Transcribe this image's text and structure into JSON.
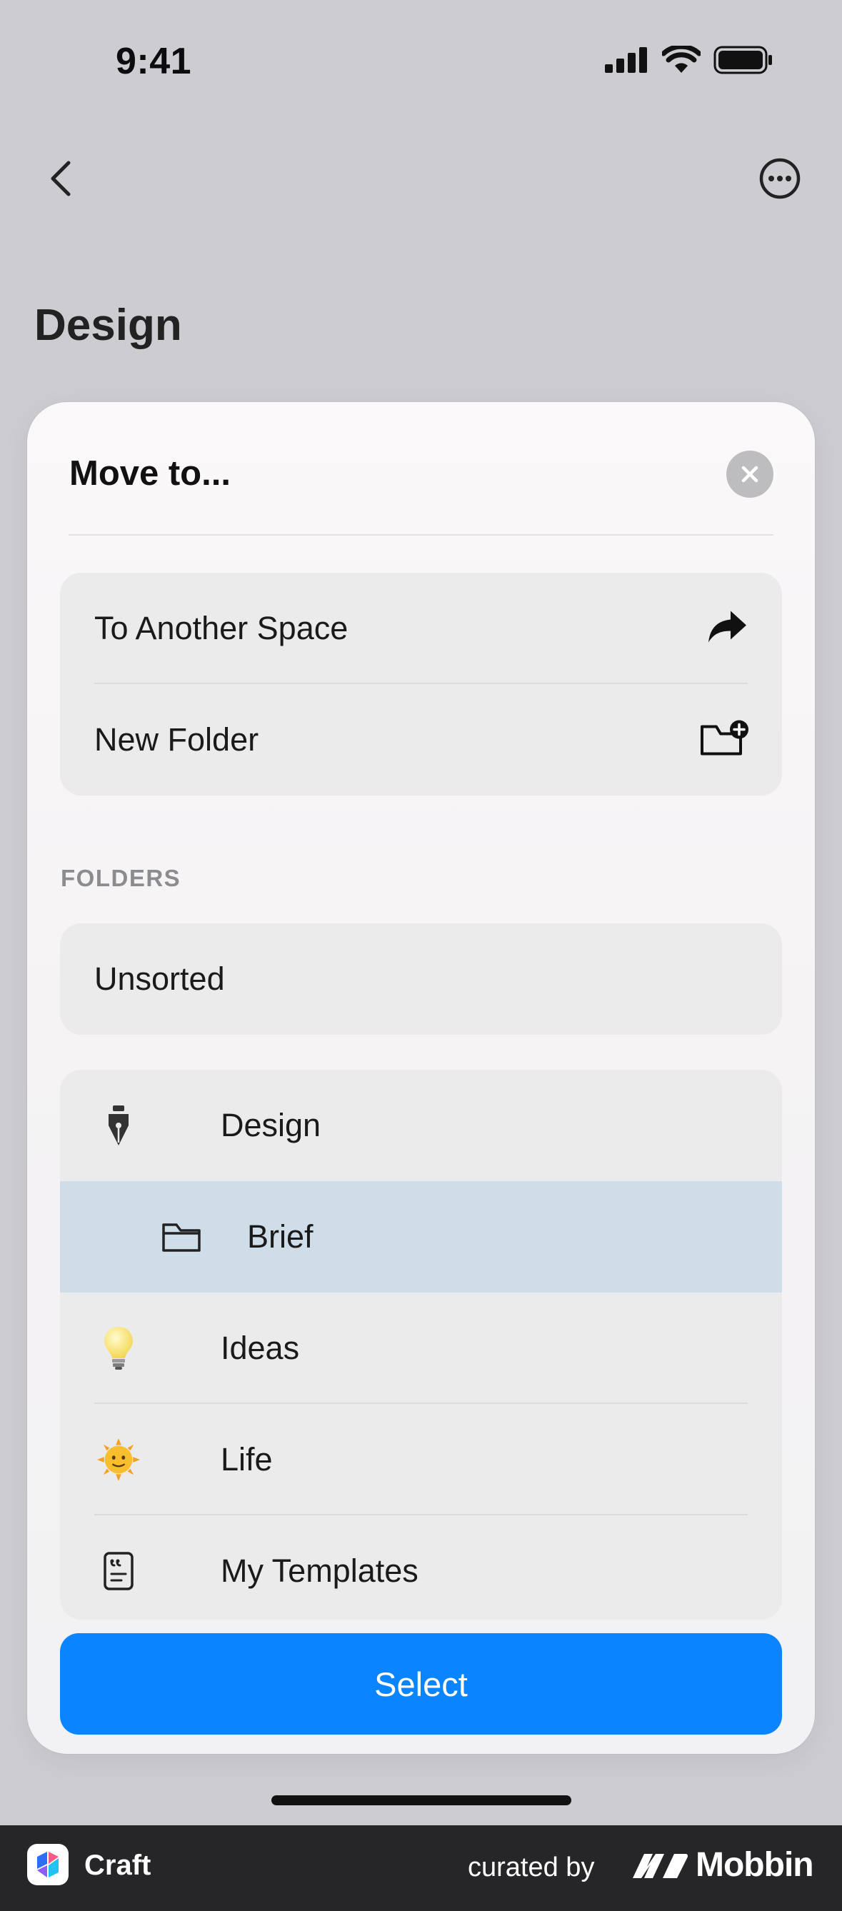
{
  "status_bar": {
    "time": "9:41"
  },
  "nav": {
    "back_icon": "chevron-left-icon",
    "more_icon": "ellipsis-circle-icon"
  },
  "page": {
    "title": "Design"
  },
  "sheet": {
    "title": "Move to...",
    "close_icon": "close-icon",
    "actions": [
      {
        "label": "To Another Space",
        "icon": "share-arrow-icon"
      },
      {
        "label": "New Folder",
        "icon": "folder-plus-icon"
      }
    ],
    "section_header": "FOLDERS",
    "unsorted_label": "Unsorted",
    "folders": [
      {
        "label": "Design",
        "icon": "fountain-pen-icon"
      },
      {
        "label": "Brief",
        "icon": "folder-icon",
        "selected": true
      },
      {
        "label": "Ideas",
        "icon": "lightbulb-icon"
      },
      {
        "label": "Life",
        "icon": "sun-face-icon"
      },
      {
        "label": "My Templates",
        "icon": "template-doc-icon"
      }
    ],
    "select_label": "Select"
  },
  "colors": {
    "accent": "#0a84ff",
    "selected_row": "#cfdde9",
    "sheet_bg": "#f5f3f4",
    "card_bg": "#ecebec",
    "footer_bg": "#262629"
  },
  "footer": {
    "app_name": "Craft",
    "curated_by": "curated by",
    "brand": "Mobbin"
  }
}
